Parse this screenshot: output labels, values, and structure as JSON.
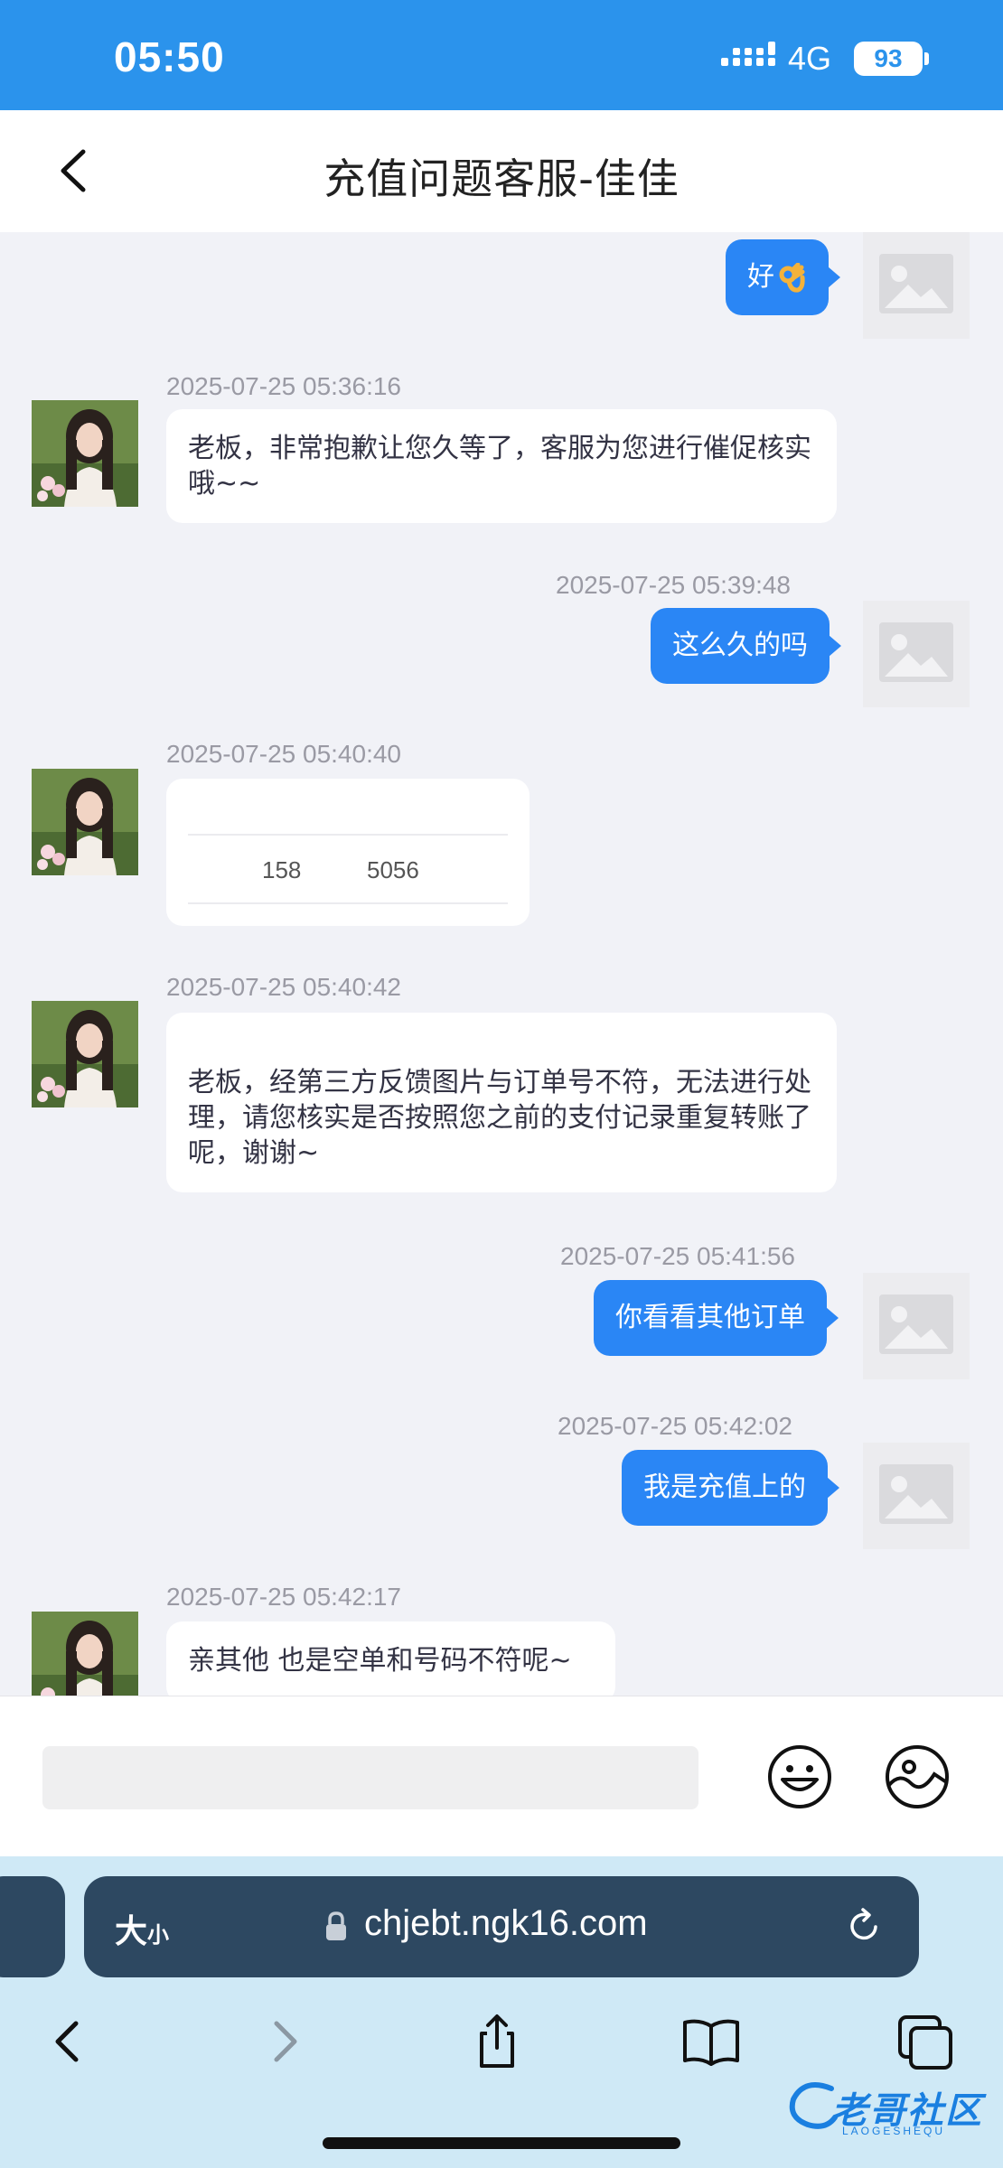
{
  "status_bar": {
    "time": "05:50",
    "network": "4G",
    "battery": "93"
  },
  "header": {
    "title": "充值问题客服-佳佳"
  },
  "messages": [
    {
      "side": "right",
      "timestamp": "",
      "text": "好"
    },
    {
      "side": "left",
      "timestamp": "2025-07-25 05:36:16",
      "text": "老板，非常抱歉让您久等了，客服为您进行催促核实哦~~"
    },
    {
      "side": "right",
      "timestamp": "2025-07-25 05:39:48",
      "text": "这么久的吗"
    },
    {
      "side": "left",
      "timestamp": "2025-07-25 05:40:40",
      "text_a": "158",
      "text_b": "5056"
    },
    {
      "side": "left",
      "timestamp": "2025-07-25 05:40:42",
      "text": "老板，经第三方反馈图片与订单号不符，无法进行处理，请您核实是否按照您之前的支付记录重复转账了呢，谢谢~"
    },
    {
      "side": "right",
      "timestamp": "2025-07-25 05:41:56",
      "text": "你看看其他订单"
    },
    {
      "side": "right",
      "timestamp": "2025-07-25 05:42:02",
      "text": "我是充值上的"
    },
    {
      "side": "left",
      "timestamp": "2025-07-25 05:42:17",
      "text": "亲其他 也是空单和号码不符呢~"
    }
  ],
  "input": {
    "placeholder": "",
    "value": ""
  },
  "browser": {
    "text_size_big": "大",
    "text_size_small": "小",
    "url": "chjebt.ngk16.com"
  },
  "watermark": {
    "text": "老哥社区",
    "sub": "LAOGESHEQU"
  },
  "colors": {
    "accent": "#2a86f5",
    "status_bar": "#2b93ec",
    "chat_bg": "#f1f2f7",
    "browser_bar": "#2d4861"
  },
  "icons": {
    "back": "chevron-left-icon",
    "emoji": "smiley-icon",
    "image": "image-icon",
    "lock": "lock-icon",
    "reload": "reload-icon",
    "share": "share-icon",
    "bookmarks": "book-icon",
    "tabs": "tabs-icon"
  }
}
